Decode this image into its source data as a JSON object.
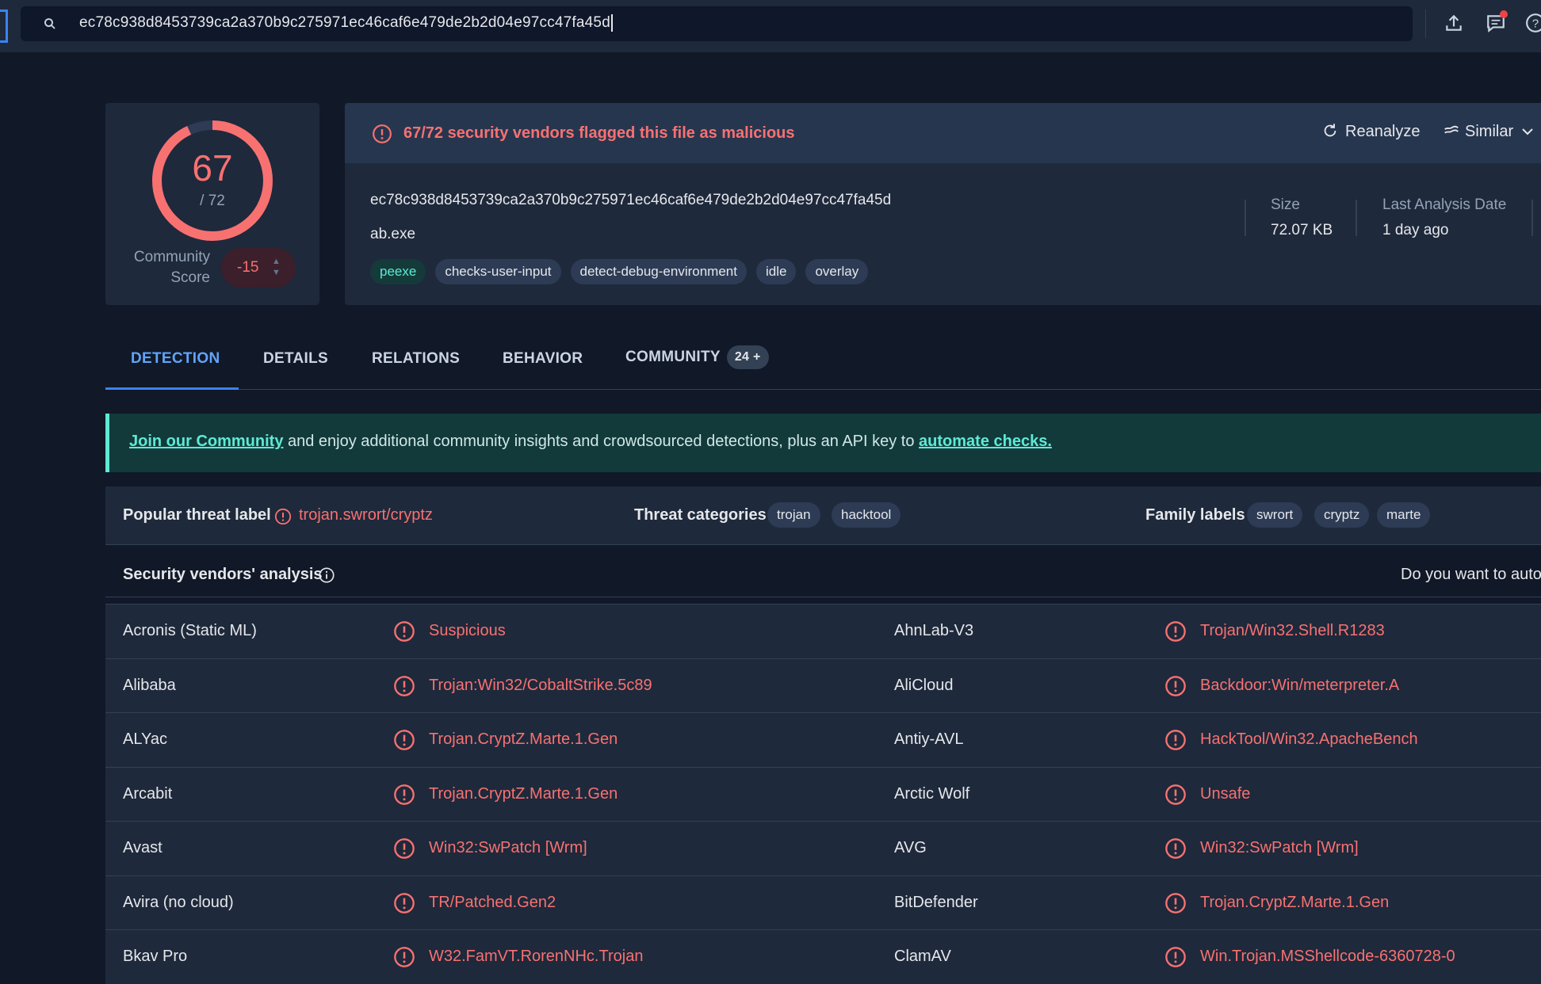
{
  "search": {
    "query": "ec78c938d8453739ca2a370b9c275971ec46caf6e479de2b2d04e97cc47fa45d"
  },
  "score": {
    "detections": "67",
    "total": "/ 72",
    "community_label": "Community Score",
    "community_value": "-15",
    "detection_fraction": 0.9306
  },
  "summary": {
    "alert": "67/72 security vendors flagged this file as malicious",
    "reanalyze_label": "Reanalyze",
    "similar_label": "Similar",
    "hash": "ec78c938d8453739ca2a370b9c275971ec46caf6e479de2b2d04e97cc47fa45d",
    "filename": "ab.exe",
    "tags": [
      "peexe",
      "checks-user-input",
      "detect-debug-environment",
      "idle",
      "overlay"
    ],
    "size_label": "Size",
    "size_value": "72.07 KB",
    "date_label": "Last Analysis Date",
    "date_value": "1 day ago"
  },
  "tabs": [
    {
      "label": "DETECTION",
      "active": true
    },
    {
      "label": "DETAILS"
    },
    {
      "label": "RELATIONS"
    },
    {
      "label": "BEHAVIOR"
    },
    {
      "label": "COMMUNITY",
      "badge": "24 +"
    }
  ],
  "banner": {
    "link1": "Join our Community",
    "middle": " and enjoy additional community insights and crowdsourced detections, plus an API key to ",
    "link2": "automate checks."
  },
  "threat": {
    "popular_label": "Popular threat label",
    "popular_value": "trojan.swrort/cryptz",
    "categories_label": "Threat categories",
    "categories": [
      "trojan",
      "hacktool"
    ],
    "family_label": "Family labels",
    "families": [
      "swrort",
      "cryptz",
      "marte"
    ]
  },
  "vendors": {
    "title": "Security vendors' analysis",
    "automate_prompt": "Do you want to auto",
    "rows": [
      {
        "left_name": "Acronis (Static ML)",
        "left_result": "Suspicious",
        "right_name": "AhnLab-V3",
        "right_result": "Trojan/Win32.Shell.R1283"
      },
      {
        "left_name": "Alibaba",
        "left_result": "Trojan:Win32/CobaltStrike.5c89",
        "right_name": "AliCloud",
        "right_result": "Backdoor:Win/meterpreter.A"
      },
      {
        "left_name": "ALYac",
        "left_result": "Trojan.CryptZ.Marte.1.Gen",
        "right_name": "Antiy-AVL",
        "right_result": "HackTool/Win32.ApacheBench"
      },
      {
        "left_name": "Arcabit",
        "left_result": "Trojan.CryptZ.Marte.1.Gen",
        "right_name": "Arctic Wolf",
        "right_result": "Unsafe"
      },
      {
        "left_name": "Avast",
        "left_result": "Win32:SwPatch [Wrm]",
        "right_name": "AVG",
        "right_result": "Win32:SwPatch [Wrm]"
      },
      {
        "left_name": "Avira (no cloud)",
        "left_result": "TR/Patched.Gen2",
        "right_name": "BitDefender",
        "right_result": "Trojan.CryptZ.Marte.1.Gen"
      },
      {
        "left_name": "Bkav Pro",
        "left_result": "W32.FamVT.RorenNHc.Trojan",
        "right_name": "ClamAV",
        "right_result": "Win.Trojan.MSShellcode-6360728-0"
      }
    ]
  },
  "colors": {
    "malicious": "#f87171",
    "accent": "#3b82f6",
    "banner_accent": "#5eead4"
  }
}
